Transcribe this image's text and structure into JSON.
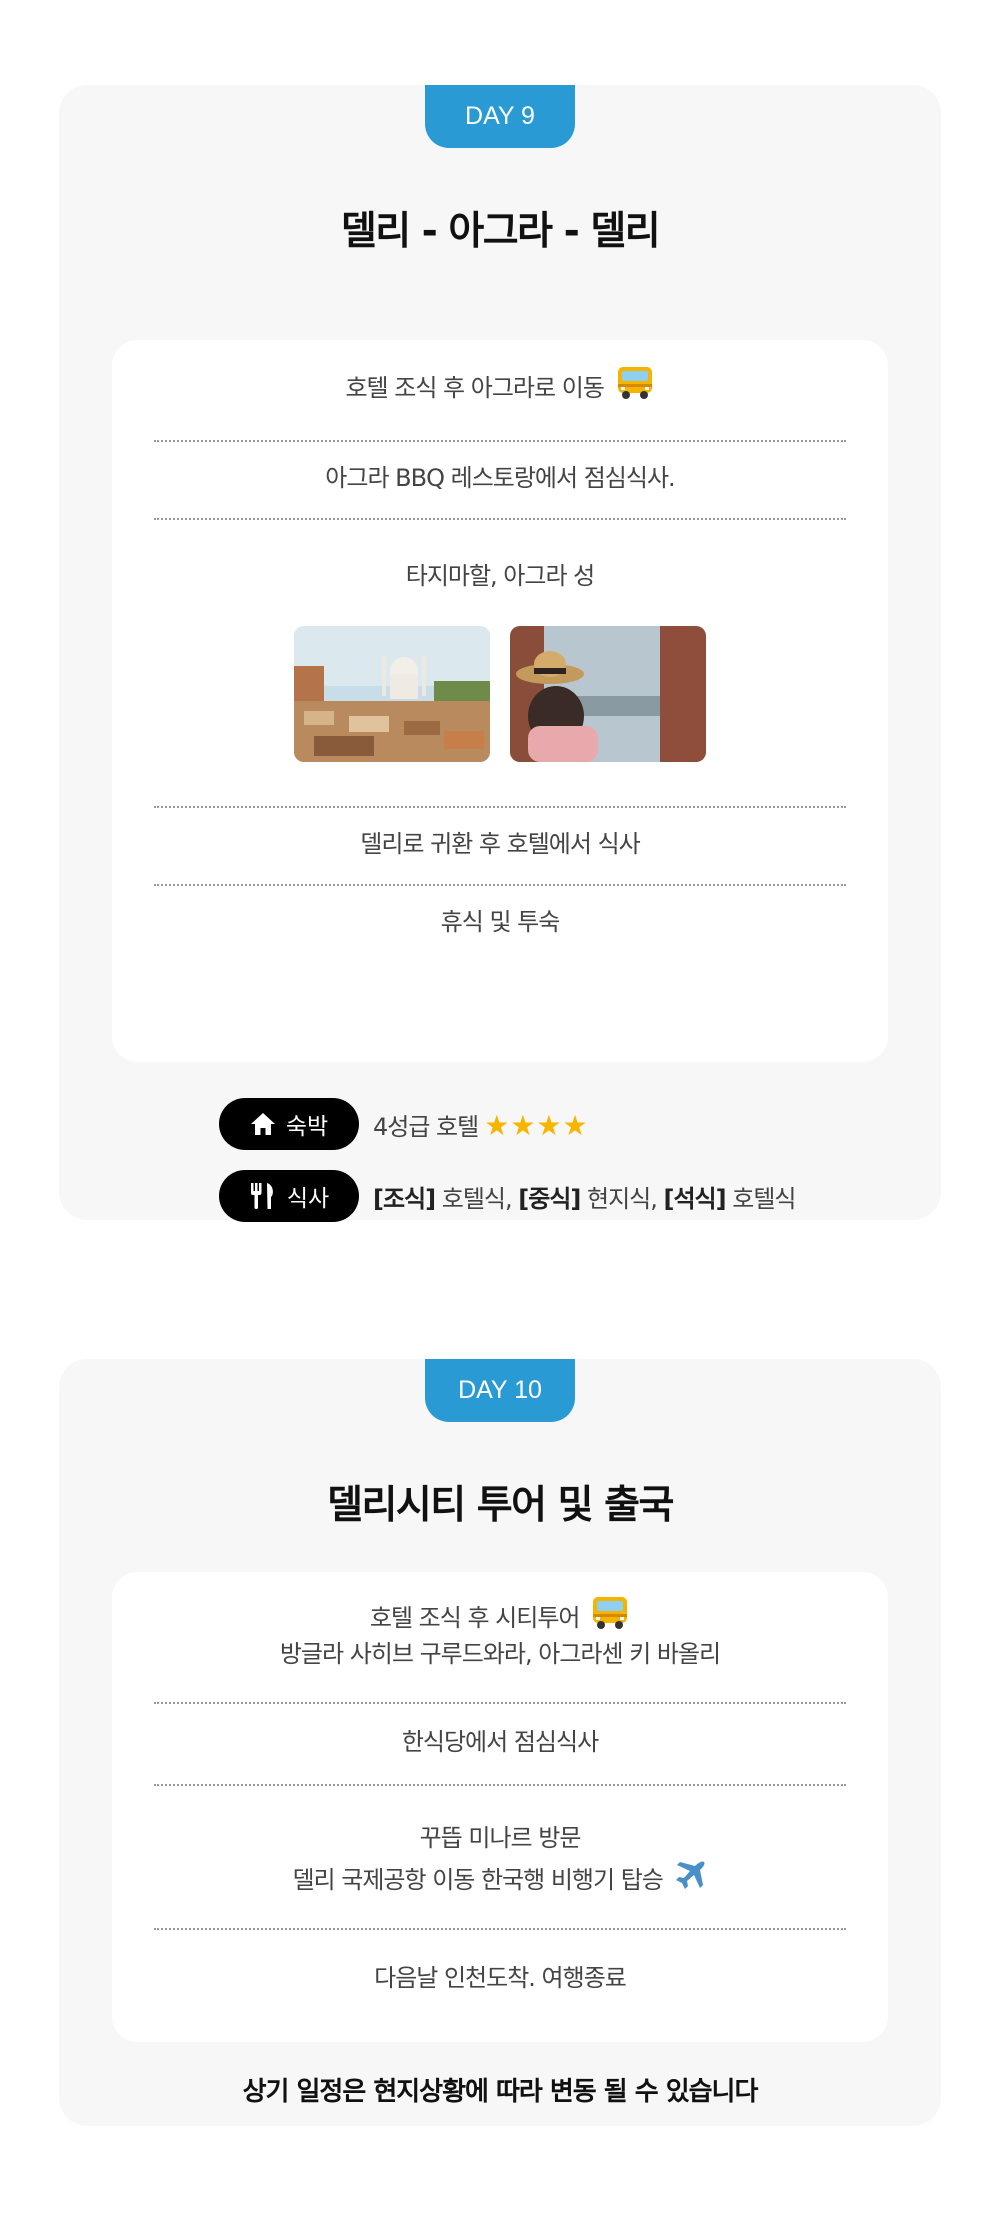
{
  "day9": {
    "tab": "DAY 9",
    "title": "델리 - 아그라 - 델리",
    "items": {
      "i1": "호텔 조식 후 아그라로 이동",
      "i2": "아그라 BBQ 레스토랑에서 점심식사.",
      "i3": "타지마할, 아그라 성",
      "i4": "델리로 귀환 후 호텔에서 식사",
      "i5": "휴식 및 투숙"
    },
    "lodging": {
      "label": "숙박",
      "text": "4성급 호텔",
      "stars": "★★★★"
    },
    "meals": {
      "label": "식사",
      "breakfast_tag": "[조식]",
      "breakfast": " 호텔식, ",
      "lunch_tag": "[중식]",
      "lunch": " 현지식, ",
      "dinner_tag": "[석식]",
      "dinner": " 호텔식"
    }
  },
  "day10": {
    "tab": "DAY 10",
    "title": "델리시티 투어 및 출국",
    "items": {
      "i1a": "호텔 조식 후 시티투어",
      "i1b": "방글라 사히브 구루드와라, 아그라센 키 바올리",
      "i2": "한식당에서 점심식사",
      "i3a": "꾸뜹 미나르 방문",
      "i3b": "델리 국제공항 이동 한국행 비행기 탑승",
      "i4": "다음날 인천도착. 여행종료"
    },
    "note": "상기 일정은 현지상황에 따라 변동 될 수 있습니다"
  },
  "icons": {
    "bus": "bus-icon",
    "plane": "airplane-icon",
    "house": "house-icon",
    "utensils": "fork-knife-icon"
  },
  "colors": {
    "accent": "#2a9ad4",
    "card_bg": "#f7f7f7",
    "pill_bg": "#000000",
    "star": "#f7b500"
  }
}
